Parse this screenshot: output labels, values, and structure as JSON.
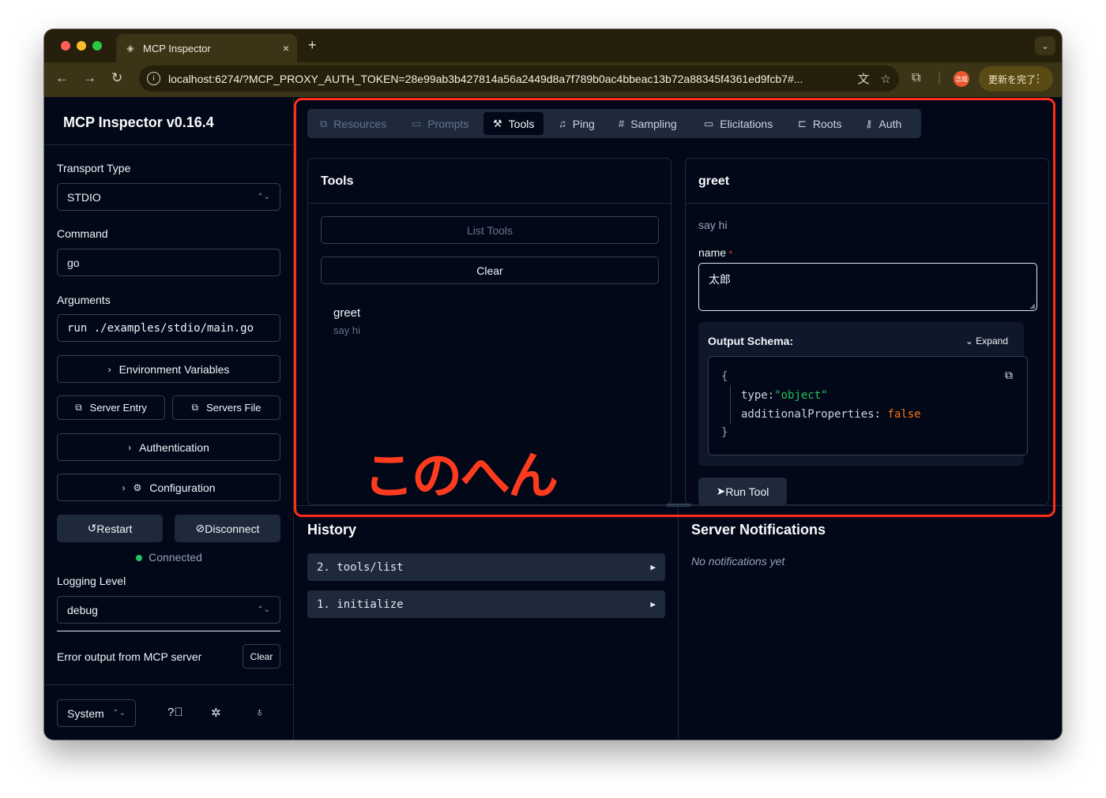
{
  "browser": {
    "tab_title": "MCP Inspector",
    "tab_close": "×",
    "new_tab": "+",
    "url": "localhost:6274/?MCP_PROXY_AUTH_TOKEN=28e99ab3b427814a56a2449d8a7f789b0ac4bbeac13b72a88345f4361ed9fcb7#...",
    "update_label": "更新を完了",
    "profile_label": "浩哉"
  },
  "sidebar": {
    "title": "MCP Inspector v0.16.4",
    "transport_label": "Transport Type",
    "transport_value": "STDIO",
    "command_label": "Command",
    "command_value": "go",
    "arguments_label": "Arguments",
    "arguments_value": "run ./examples/stdio/main.go",
    "env_button": "Environment Variables",
    "server_entry_button": "Server Entry",
    "servers_file_button": "Servers File",
    "auth_button": "Authentication",
    "config_button": "Configuration",
    "restart_button": "Restart",
    "disconnect_button": "Disconnect",
    "status": "Connected",
    "logging_label": "Logging Level",
    "logging_value": "debug",
    "error_label": "Error output from MCP server",
    "error_clear": "Clear",
    "theme_value": "System"
  },
  "tabs": [
    {
      "label": "Resources",
      "icon": "files-icon"
    },
    {
      "label": "Prompts",
      "icon": "message-icon"
    },
    {
      "label": "Tools",
      "icon": "hammer-icon"
    },
    {
      "label": "Ping",
      "icon": "bell-icon"
    },
    {
      "label": "Sampling",
      "icon": "hash-icon"
    },
    {
      "label": "Elicitations",
      "icon": "message-square-icon"
    },
    {
      "label": "Roots",
      "icon": "folder-tree-icon"
    },
    {
      "label": "Auth",
      "icon": "key-icon"
    }
  ],
  "tools_panel": {
    "title": "Tools",
    "list_button": "List Tools",
    "clear_button": "Clear",
    "tool_name": "greet",
    "tool_desc": "say hi"
  },
  "detail_panel": {
    "title": "greet",
    "description": "say hi",
    "field_label": "name",
    "required_mark": "*",
    "field_value": "太郎",
    "schema_label": "Output Schema:",
    "expand_label": "Expand",
    "schema_open": "{",
    "schema_type_key": "type:",
    "schema_type_val": "\"object\"",
    "schema_ap_key": "additionalProperties:",
    "schema_ap_val": "false",
    "schema_close": "}",
    "run_button": "Run Tool"
  },
  "history": {
    "title": "History",
    "items": [
      "2. tools/list",
      "1. initialize"
    ]
  },
  "notifications": {
    "title": "Server Notifications",
    "empty": "No notifications yet"
  },
  "annotation": {
    "text": "このへん",
    "color": "#ff3b1f"
  }
}
